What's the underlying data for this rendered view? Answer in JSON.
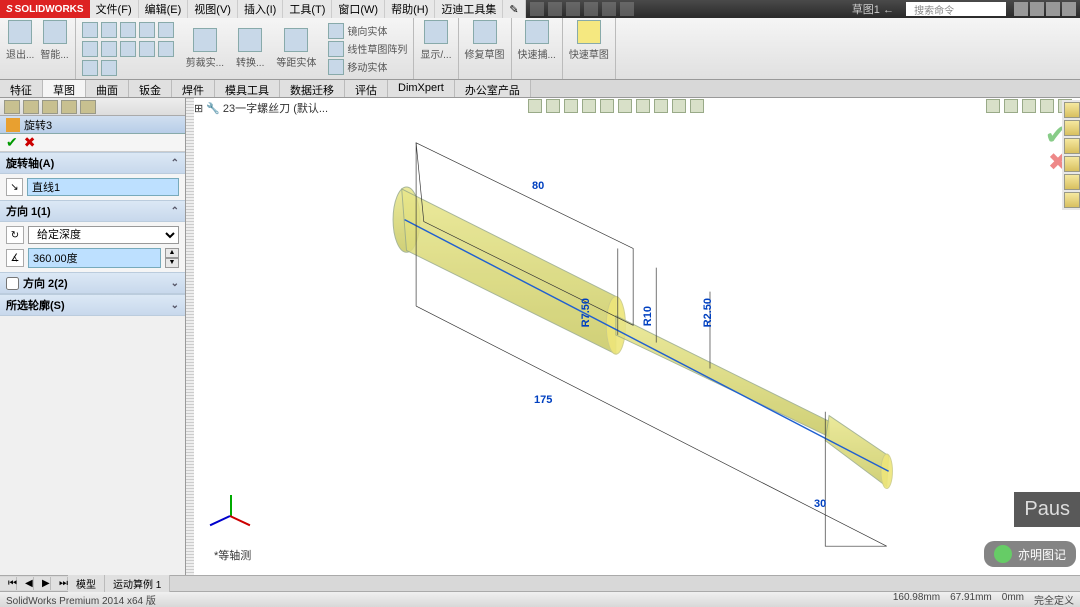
{
  "app": {
    "brand_prefix": "S",
    "brand": "SOLIDWORKS",
    "title": "草图1 ←",
    "search_placeholder": "搜索命令"
  },
  "menu": [
    "文件(F)",
    "编辑(E)",
    "视图(V)",
    "插入(I)",
    "工具(T)",
    "窗口(W)",
    "帮助(H)",
    "迈迪工具集",
    "✎"
  ],
  "ribbon": {
    "g1": {
      "big1": "退出...",
      "big2": "智能..."
    },
    "g2": {
      "items": [
        "剪裁实...",
        "转换...",
        "等距实体"
      ],
      "col2": [
        "镜向实体",
        "线性草图阵列",
        "移动实体"
      ]
    },
    "g3": {
      "big": "显示/..."
    },
    "g4": {
      "big": "修复草图"
    },
    "g5": {
      "big": "快速捕..."
    },
    "g6": {
      "big": "快速草图"
    }
  },
  "tabs": [
    "特征",
    "草图",
    "曲面",
    "钣金",
    "焊件",
    "模具工具",
    "数据迁移",
    "评估",
    "DimXpert",
    "办公室产品"
  ],
  "tree_doc": "23一字螺丝刀  (默认...",
  "feature": {
    "name": "旋转3",
    "axis_hdr": "旋转轴(A)",
    "axis_value": "直线1",
    "dir1_hdr": "方向 1(1)",
    "dir1_type": "给定深度",
    "dir1_angle": "360.00度",
    "dir2_hdr": "方向 2(2)",
    "contour_hdr": "所选轮廓(S)"
  },
  "dims": {
    "d80": "80",
    "d175": "175",
    "d30": "30",
    "r750": "R7.50",
    "r10": "R10",
    "r250": "R2.50"
  },
  "view_name": "*等轴测",
  "bottom_tabs": [
    "模型",
    "运动算例 1"
  ],
  "status": {
    "left": "SolidWorks Premium 2014 x64 版",
    "coord1": "160.98mm",
    "coord2": "67.91mm",
    "coord3": "0mm",
    "state": "完全定义"
  },
  "watermark": "亦明图记",
  "pause": "Paus"
}
